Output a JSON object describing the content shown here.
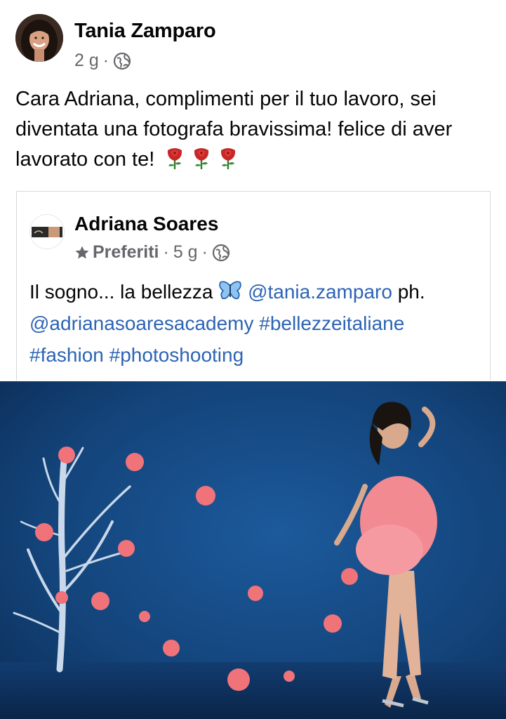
{
  "post": {
    "author": "Tania Zamparo",
    "time": "2 g",
    "text_line1": "Cara Adriana, complimenti per il tuo lavoro, sei",
    "text_line2": "diventata una fotografa bravissima! felice di aver",
    "text_line3": "lavorato con te!",
    "emojis": [
      "rose",
      "rose",
      "rose"
    ]
  },
  "shared": {
    "author": "Adriana Soares",
    "favorites_label": "Preferiti",
    "time": "5 g",
    "text_prefix": "Il sogno... la bellezza",
    "mention1": "@tania.zamparo",
    "text_ph": "ph.",
    "mention2": "@adrianasoaresacademy",
    "hashtag1": "#bellezzeitaliane",
    "hashtag2": "#fashion",
    "hashtag3": "#photoshooting"
  },
  "icons": {
    "globe": "globe-icon",
    "star": "star-icon",
    "butterfly": "butterfly-icon",
    "rose": "rose-icon"
  },
  "colors": {
    "link": "#2d64b4",
    "meta": "#65676b",
    "photo_background": "#12407a",
    "flowers": "#f0737a"
  }
}
